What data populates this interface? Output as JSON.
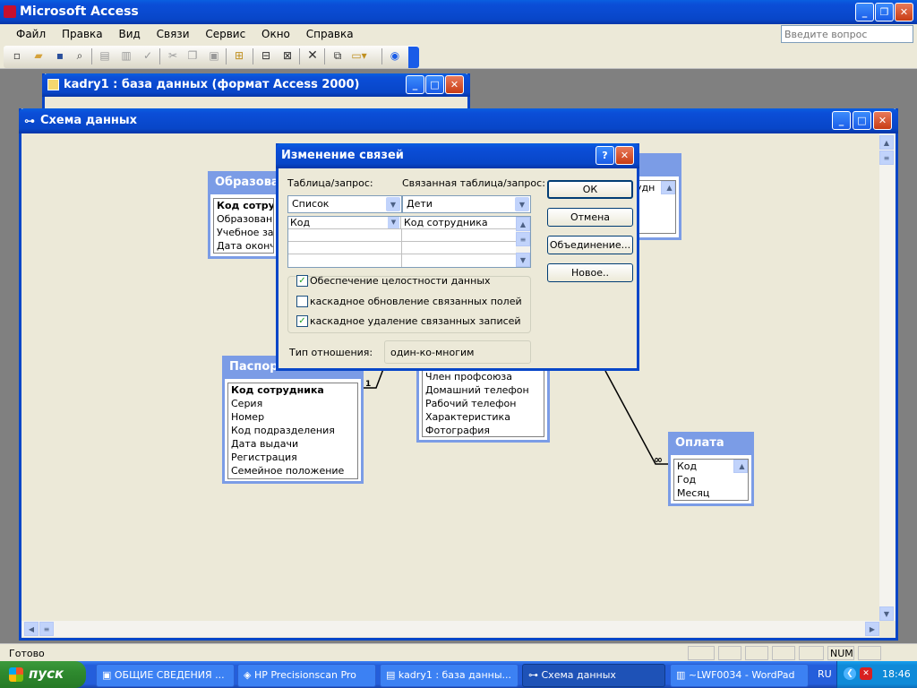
{
  "app": {
    "title": "Microsoft Access"
  },
  "menu": [
    "Файл",
    "Правка",
    "Вид",
    "Связи",
    "Сервис",
    "Окно",
    "Справка"
  ],
  "help_box": {
    "placeholder": "Введите вопрос"
  },
  "toolbar_icons": [
    "new-icon",
    "open-icon",
    "save-icon",
    "search-icon",
    "print-icon",
    "print-preview-icon",
    "spelling-icon",
    "cut-icon",
    "copy-icon",
    "paste-icon",
    "show-table-icon",
    "show-direct-icon",
    "show-all-icon",
    "delete-icon",
    "database-window-icon",
    "new-object-icon",
    "help-icon"
  ],
  "db_window": {
    "title": "kadry1 : база данных (формат Access 2000)"
  },
  "schema_window": {
    "title": "Схема данных"
  },
  "tables": {
    "education": {
      "title": "Образова...",
      "fields": [
        "Код сотрудн",
        "Образование",
        "Учебное заве",
        "Дата оконча"
      ]
    },
    "passport": {
      "title": "Паспорт",
      "fields": [
        "Код сотрудника",
        "Серия",
        "Номер",
        "Код подразделения",
        "Дата выдачи",
        "Регистрация",
        "Семейное положение"
      ]
    },
    "employees": {
      "fields": [
        "Член профсоюза",
        "Домашний телефон",
        "Рабочий телефон",
        "Характеристика",
        "Фотография"
      ]
    },
    "right_top": {
      "fields": [
        "удн",
        "",
        ""
      ]
    },
    "payment": {
      "title": "Оплата",
      "fields": [
        "Код",
        "Год",
        "Месяц"
      ]
    }
  },
  "relation_labels": {
    "one": "1",
    "many": "∞"
  },
  "dialog": {
    "title": "Изменение связей",
    "table_label": "Таблица/запрос:",
    "related_label": "Связанная таблица/запрос:",
    "table_value": "Список",
    "related_value": "Дети",
    "grid_left": "Код",
    "grid_right": "Код сотрудника",
    "integrity_label": "Обеспечение целостности данных",
    "cascade_update_label": "каскадное обновление связанных полей",
    "cascade_delete_label": "каскадное удаление связанных записей",
    "integrity_checked": true,
    "cascade_update_checked": false,
    "cascade_delete_checked": true,
    "relation_type_label": "Тип отношения:",
    "relation_type_value": "один-ко-многим",
    "buttons": {
      "ok": "ОК",
      "cancel": "Отмена",
      "join": "Объединение...",
      "new": "Новое.."
    }
  },
  "status": {
    "text": "Готово",
    "num": "NUM"
  },
  "taskbar": {
    "start": "пуск",
    "tasks": [
      "ОБЩИЕ СВЕДЕНИЯ ...",
      "HP Precisionscan Pro",
      "kadry1 : база данны...",
      "Схема данных",
      "~LWF0034 - WordPad"
    ],
    "lang": "RU",
    "clock": "18:46"
  }
}
